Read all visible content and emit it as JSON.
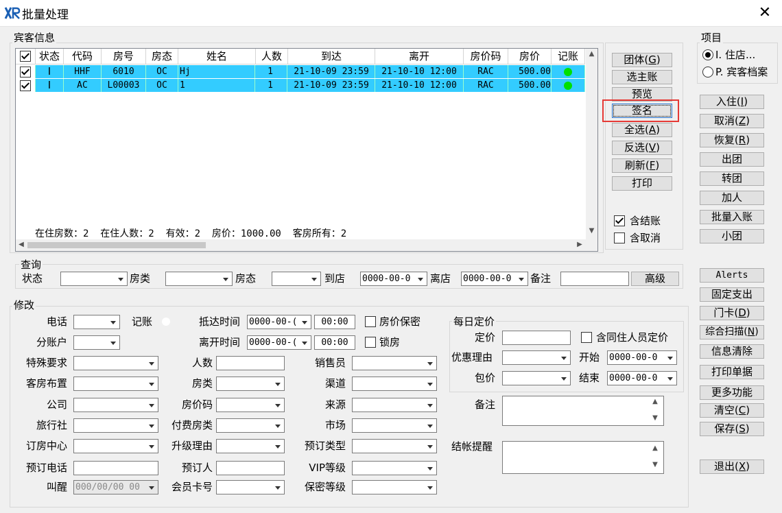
{
  "window": {
    "title": "批量处理",
    "close": "✕"
  },
  "guest_group": {
    "label": "宾客信息",
    "columns": [
      "状态",
      "代码",
      "房号",
      "房态",
      "姓名",
      "人数",
      "到达",
      "离开",
      "房价码",
      "房价",
      "记账"
    ],
    "rows": [
      {
        "status": "I",
        "code": "HHF",
        "room": "6010",
        "room_state": "OC",
        "name": "Hj",
        "count": "1",
        "arrive": "21-10-09 23:59",
        "depart": "21-10-10 12:00",
        "rate_code": "RAC",
        "rate": "500.00"
      },
      {
        "status": "I",
        "code": "AC",
        "room": "L00003",
        "room_state": "OC",
        "name": "1",
        "count": "1",
        "arrive": "21-10-09 23:59",
        "depart": "21-10-10 12:00",
        "rate_code": "RAC",
        "rate": "500.00"
      }
    ],
    "summary": "在住房数：2  在住人数：2  有效：2  房价：1000.00  客房所有：2"
  },
  "side_buttons": [
    {
      "text": "团体",
      "key": "G"
    },
    {
      "text": "选主账",
      "key": ""
    },
    {
      "text": "预览",
      "key": ""
    },
    {
      "text": "签名",
      "key": ""
    },
    {
      "text": "全选",
      "key": "A"
    },
    {
      "text": "反选",
      "key": "V"
    },
    {
      "text": "刷新",
      "key": "F"
    },
    {
      "text": "打印",
      "key": ""
    }
  ],
  "include": {
    "settled": "含结账",
    "cancelled": "含取消"
  },
  "project": {
    "label": "项目",
    "opt1": "I. 住店...",
    "opt2": "P. 宾客档案"
  },
  "right_buttons": [
    {
      "text": "入住",
      "key": "I"
    },
    {
      "text": "取消",
      "key": "Z"
    },
    {
      "text": "恢复",
      "key": "R"
    },
    {
      "text": "出团",
      "key": ""
    },
    {
      "text": "转团",
      "key": ""
    },
    {
      "text": "加人",
      "key": ""
    },
    {
      "text": "批量入账",
      "key": ""
    },
    {
      "text": "小团",
      "key": ""
    },
    {
      "text": "Alerts",
      "key": ""
    },
    {
      "text": "固定支出",
      "key": ""
    },
    {
      "text": "门卡",
      "key": "D"
    },
    {
      "text": "综合扫描",
      "key": "N"
    },
    {
      "text": "信息清除",
      "key": ""
    },
    {
      "text": "打印单据",
      "key": ""
    },
    {
      "text": "更多功能",
      "key": ""
    },
    {
      "text": "清空",
      "key": "C"
    },
    {
      "text": "保存",
      "key": "S"
    },
    {
      "text": "退出",
      "key": "X"
    }
  ],
  "query": {
    "label": "查询",
    "status": "状态",
    "room_type": "房类",
    "room_state": "房态",
    "arrive": "到店",
    "arrive_val": "0000-00-0",
    "depart": "离店",
    "depart_val": "0000-00-0",
    "remark": "备注",
    "advanced": "高级"
  },
  "modify": {
    "label": "修改",
    "phone": "电话",
    "account": "记账",
    "arrive_time": "抵达时间",
    "arrive_date": "0000-00-(",
    "arrive_hm": "00:00",
    "rate_secret": "房价保密",
    "sub_account": "分账户",
    "depart_time": "离开时间",
    "depart_date": "0000-00-(",
    "depart_hm": "00:00",
    "lock_room": "锁房",
    "special": "特殊要求",
    "persons": "人数",
    "salesman": "销售员",
    "room_layout": "客房布置",
    "room_type": "房类",
    "channel": "渠道",
    "company": "公司",
    "rate_code": "房价码",
    "source": "来源",
    "agency": "旅行社",
    "paid_type": "付费房类",
    "market": "市场",
    "center": "订房中心",
    "upgrade": "升级理由",
    "book_type": "预订类型",
    "book_phone": "预订电话",
    "booker": "预订人",
    "vip": "VIP等级",
    "wakeup": "叫醒",
    "wakeup_val": "000/00/00 00",
    "member": "会员卡号",
    "secret": "保密等级"
  },
  "daily": {
    "label": "每日定价",
    "price": "定价",
    "same": "含同住人员定价",
    "reason": "优惠理由",
    "start": "开始",
    "start_val": "0000-00-0",
    "pack": "包价",
    "end": "结束",
    "end_val": "0000-00-0",
    "remark": "备注",
    "checkout_note": "结帐提醒"
  },
  "colors": {
    "row": "#33ccff",
    "highlight": "#e53935",
    "dot": "#00e000"
  }
}
